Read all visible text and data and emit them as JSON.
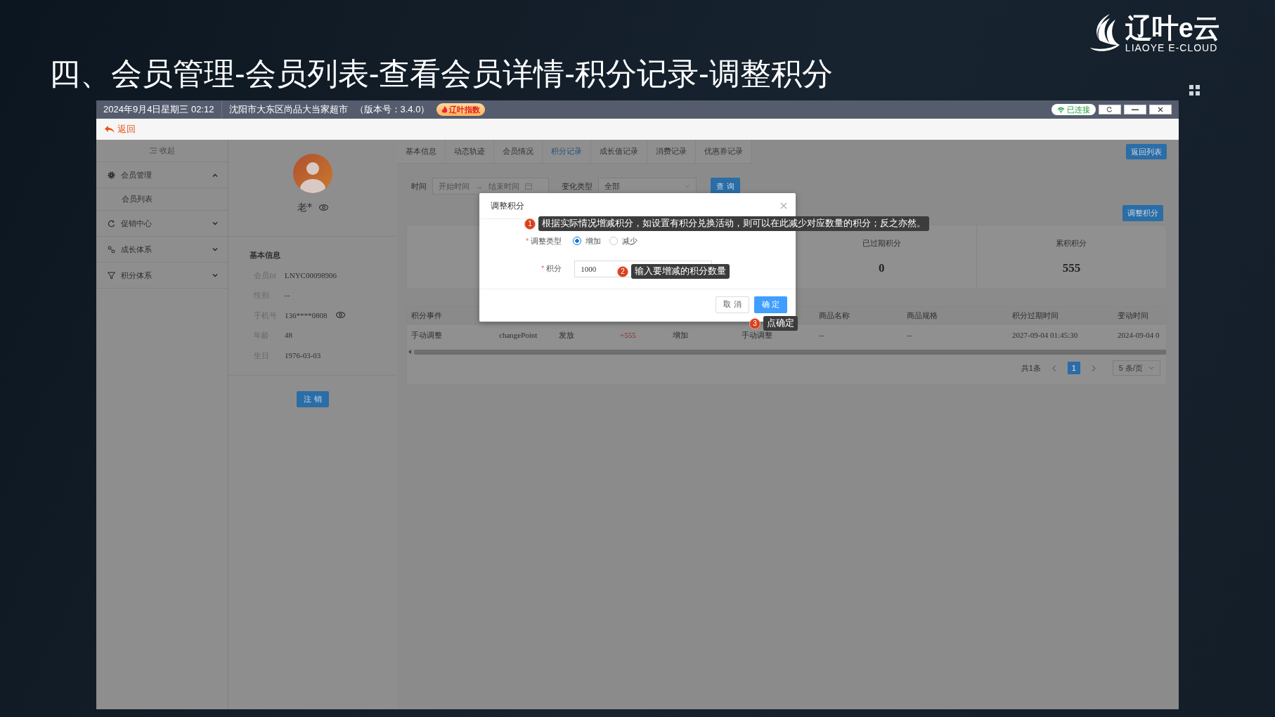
{
  "slide": {
    "title": "四、会员管理-会员列表-查看会员详情-积分记录-调整积分",
    "logo_text": "辽叶e云",
    "logo_subtitle": "LIAOYE E-CLOUD"
  },
  "status_bar": {
    "datetime": "2024年9月4日星期三 02:12",
    "store": "沈阳市大东区尚品大当家超市",
    "version": "（版本号：3.4.0）",
    "badge": "辽叶指数",
    "connection": "已连接"
  },
  "back_link": "返回",
  "sidebar": {
    "collapse": "收起",
    "items": [
      {
        "label": "会员管理",
        "expanded": true,
        "children": [
          {
            "label": "会员列表"
          }
        ]
      },
      {
        "label": "促销中心",
        "expanded": false
      },
      {
        "label": "成长体系",
        "expanded": false
      },
      {
        "label": "积分体系",
        "expanded": false
      }
    ]
  },
  "profile": {
    "name": "老*",
    "section_title": "基本信息",
    "fields": [
      {
        "label": "会员Id",
        "value": "LNYC00098906",
        "kind": "plain"
      },
      {
        "label": "性别",
        "value": "--",
        "kind": "plain"
      },
      {
        "label": "手机号",
        "value": "136****0808",
        "kind": "masked"
      },
      {
        "label": "年龄",
        "value": "48",
        "kind": "plain"
      },
      {
        "label": "生日",
        "value": "1976-03-03",
        "kind": "plain"
      }
    ],
    "cancel_button": "注 销"
  },
  "tabs": [
    {
      "label": "基本信息",
      "selected": false
    },
    {
      "label": "动态轨迹",
      "selected": false
    },
    {
      "label": "会员情况",
      "selected": false
    },
    {
      "label": "积分记录",
      "selected": true
    },
    {
      "label": "成长值记录",
      "selected": false
    },
    {
      "label": "消费记录",
      "selected": false
    },
    {
      "label": "优惠券记录",
      "selected": false
    }
  ],
  "back_to_list": "返回列表",
  "filter": {
    "time_label": "时间",
    "start_placeholder": "开始时间",
    "range_arrow": "→",
    "end_placeholder": "结束时间",
    "type_label": "变化类型",
    "type_value": "全部",
    "query_button": "查 询"
  },
  "adjust_button": "调整积分",
  "summary": [
    {
      "label": "已过期积分",
      "value": "0"
    },
    {
      "label": "累积积分",
      "value": "555"
    }
  ],
  "table": {
    "columns": [
      {
        "label": "积分事件"
      },
      {},
      {},
      {
        "kind": "points"
      },
      {},
      {},
      {
        "label": "商品名称"
      },
      {
        "label": "商品规格"
      },
      {
        "label": "积分过期时间"
      },
      {
        "label": "变动时间"
      }
    ],
    "rows": [
      [
        "手动调整",
        "changePoint",
        "发放",
        "+555",
        "增加",
        "手动调整",
        "--",
        "--",
        "2027-09-04 01:45:30",
        "2024-09-04 0"
      ]
    ]
  },
  "pagination": {
    "total": "共1条",
    "pages": [
      {
        "label": "1",
        "selected": true
      }
    ],
    "page_size": "5 条/页"
  },
  "dialog": {
    "title": "调整积分",
    "type_required_mark": "*",
    "type_label": "调整类型",
    "options": [
      {
        "label": "增加",
        "selected": true
      },
      {
        "label": "减少",
        "selected": false
      }
    ],
    "points_required_mark": "*",
    "points_label": "积分",
    "points_value": "1000",
    "cancel_button": "取 消",
    "ok_button": "确 定"
  },
  "callouts": [
    {
      "number": "1",
      "text": "根据实际情况增减积分，如设置有积分兑换活动，则可以在此减少对应数量的积分；反之亦然。"
    },
    {
      "number": "2",
      "text": "输入要增减的积分数量"
    },
    {
      "number": "3",
      "text": "点确定"
    }
  ]
}
